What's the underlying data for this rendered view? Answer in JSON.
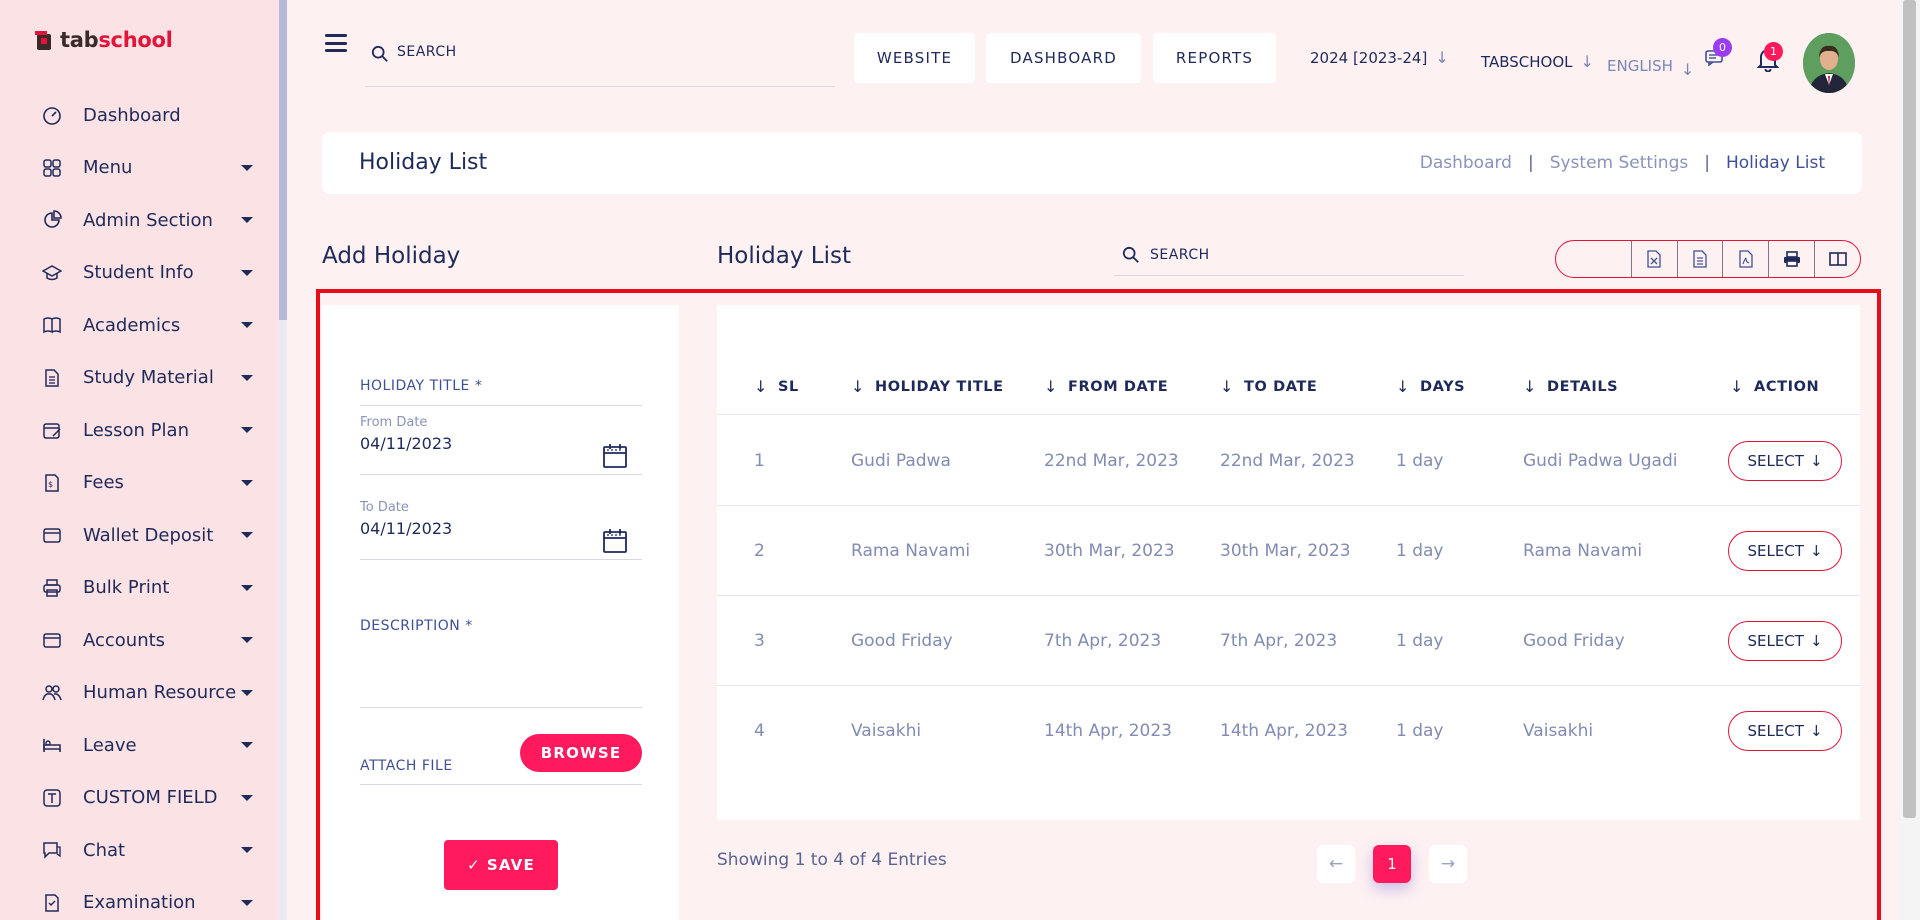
{
  "brand": {
    "part1": "tab",
    "part2": "school"
  },
  "sidebar": {
    "items": [
      {
        "label": "Dashboard",
        "icon": "speedometer-icon",
        "has_caret": false
      },
      {
        "label": "Menu",
        "icon": "grid-icon",
        "has_caret": true
      },
      {
        "label": "Admin Section",
        "icon": "pie-chart-icon",
        "has_caret": true
      },
      {
        "label": "Student Info",
        "icon": "graduation-cap-icon",
        "has_caret": true
      },
      {
        "label": "Academics",
        "icon": "book-icon",
        "has_caret": true
      },
      {
        "label": "Study Material",
        "icon": "document-icon",
        "has_caret": true
      },
      {
        "label": "Lesson Plan",
        "icon": "calendar-edit-icon",
        "has_caret": true
      },
      {
        "label": "Fees",
        "icon": "invoice-icon",
        "has_caret": true
      },
      {
        "label": "Wallet Deposit",
        "icon": "wallet-icon",
        "has_caret": true
      },
      {
        "label": "Bulk Print",
        "icon": "printer-icon",
        "has_caret": true
      },
      {
        "label": "Accounts",
        "icon": "wallet-icon",
        "has_caret": true
      },
      {
        "label": "Human Resource",
        "icon": "users-icon",
        "has_caret": true
      },
      {
        "label": "Leave",
        "icon": "bed-icon",
        "has_caret": true
      },
      {
        "label": "CUSTOM FIELD",
        "icon": "text-box-icon",
        "has_caret": true
      },
      {
        "label": "Chat",
        "icon": "chat-icon",
        "has_caret": true
      },
      {
        "label": "Examination",
        "icon": "exam-icon",
        "has_caret": true
      }
    ]
  },
  "header": {
    "search_placeholder": "SEARCH",
    "buttons": {
      "website": "WEBSITE",
      "dashboard": "DASHBOARD",
      "reports": "REPORTS"
    },
    "session": "2024 [2023-24]",
    "school": "TABSCHOOL",
    "language": "ENGLISH",
    "messages_count": "0",
    "notifications_count": "1"
  },
  "page": {
    "title": "Holiday List",
    "breadcrumb": [
      "Dashboard",
      "System Settings",
      "Holiday List"
    ]
  },
  "form": {
    "heading": "Add Holiday",
    "holiday_title_label": "HOLIDAY TITLE *",
    "from_date_label": "From Date",
    "from_date_value": "04/11/2023",
    "to_date_label": "To Date",
    "to_date_value": "04/11/2023",
    "description_label": "DESCRIPTION *",
    "attach_label": "ATTACH FILE",
    "browse_label": "BROWSE",
    "save_label": "SAVE"
  },
  "list": {
    "heading": "Holiday List",
    "search_placeholder": "SEARCH",
    "columns": [
      "SL",
      "HOLIDAY TITLE",
      "FROM DATE",
      "TO DATE",
      "DAYS",
      "DETAILS",
      "ACTION"
    ],
    "rows": [
      {
        "sl": "1",
        "title": "Gudi Padwa",
        "from": "22nd Mar, 2023",
        "to": "22nd Mar, 2023",
        "days": "1 day",
        "details": "Gudi Padwa Ugadi",
        "action": "SELECT"
      },
      {
        "sl": "2",
        "title": "Rama Navami",
        "from": "30th Mar, 2023",
        "to": "30th Mar, 2023",
        "days": "1 day",
        "details": "Rama Navami",
        "action": "SELECT"
      },
      {
        "sl": "3",
        "title": "Good Friday",
        "from": "7th Apr, 2023",
        "to": "7th Apr, 2023",
        "days": "1 day",
        "details": "Good Friday",
        "action": "SELECT"
      },
      {
        "sl": "4",
        "title": "Vaisakhi",
        "from": "14th Apr, 2023",
        "to": "14th Apr, 2023",
        "days": "1 day",
        "details": "Vaisakhi",
        "action": "SELECT"
      }
    ],
    "showing": "Showing 1 to 4 of 4 Entries",
    "current_page": "1"
  },
  "colors": {
    "accent": "#ff1a5e",
    "primary_text": "#1f2a5a",
    "sidebar_bg": "#fbe2e4",
    "page_bg": "#fdf1f2"
  }
}
